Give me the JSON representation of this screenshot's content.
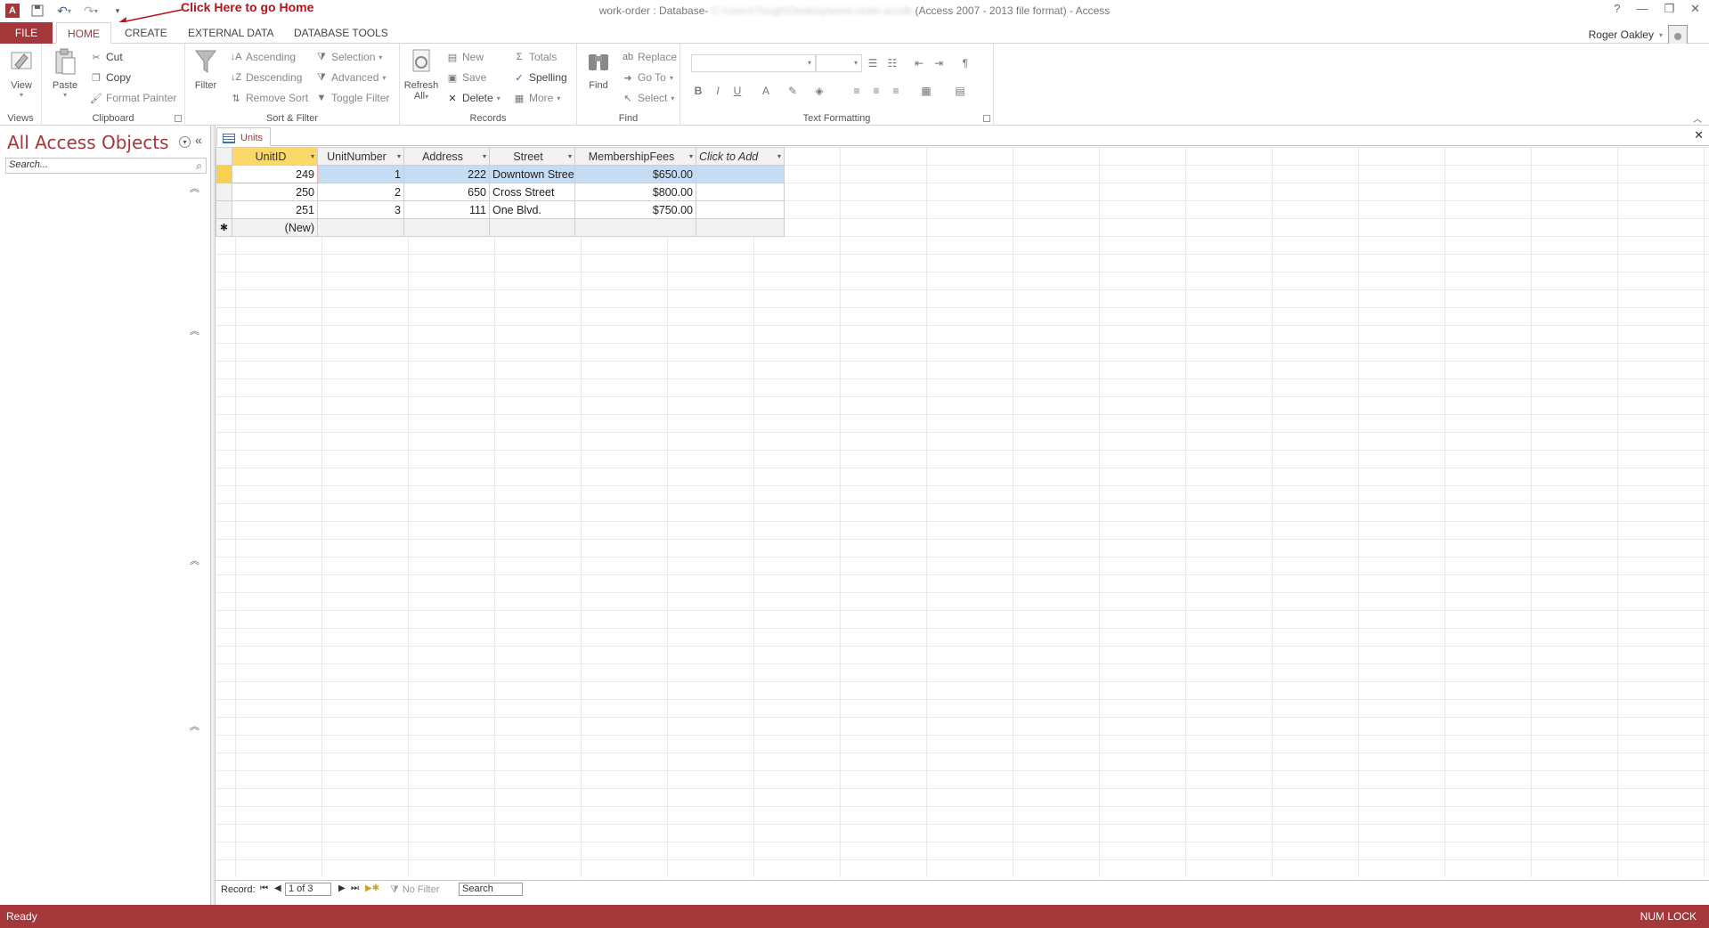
{
  "titlebar": {
    "title_prefix": "work-order : Database-",
    "title_blurred": "C:\\Users\\Tough\\Desktop\\work-order.accdb",
    "title_suffix": "(Access 2007 - 2013 file format) - Access",
    "annotation": "Click Here to go Home",
    "help": "?",
    "minimize": "—",
    "restore": "❐",
    "close": "✕"
  },
  "tabs": {
    "file": "FILE",
    "home": "HOME",
    "create": "CREATE",
    "external": "EXTERNAL DATA",
    "dbtools": "DATABASE TOOLS"
  },
  "user": {
    "name": "Roger Oakley"
  },
  "ribbon": {
    "views": {
      "label": "Views",
      "view": "View"
    },
    "clipboard": {
      "label": "Clipboard",
      "paste": "Paste",
      "cut": "Cut",
      "copy": "Copy",
      "format_painter": "Format Painter"
    },
    "sortfilter": {
      "label": "Sort & Filter",
      "filter": "Filter",
      "ascending": "Ascending",
      "descending": "Descending",
      "remove_sort": "Remove Sort",
      "selection": "Selection",
      "advanced": "Advanced",
      "toggle_filter": "Toggle Filter"
    },
    "records": {
      "label": "Records",
      "refresh": "Refresh",
      "refresh_all": "All",
      "new": "New",
      "save": "Save",
      "delete": "Delete",
      "totals": "Totals",
      "spelling": "Spelling",
      "more": "More"
    },
    "find": {
      "label": "Find",
      "find": "Find",
      "replace": "Replace",
      "goto": "Go To",
      "select": "Select"
    },
    "textformatting": {
      "label": "Text Formatting",
      "bold": "B",
      "italic": "I",
      "underline": "U",
      "fontcolor": "A"
    }
  },
  "navpane": {
    "title": "All Access Objects",
    "search_placeholder": "Search...",
    "collapse": "«"
  },
  "document": {
    "tab_label": "Units",
    "close": "✕"
  },
  "datasheet": {
    "columns": [
      "UnitID",
      "UnitNumber",
      "Address",
      "Street",
      "MembershipFees",
      "Click to Add"
    ],
    "rows": [
      [
        "249",
        "1",
        "222",
        "Downtown Street",
        "$650.00"
      ],
      [
        "250",
        "2",
        "650",
        "Cross Street",
        "$800.00"
      ],
      [
        "251",
        "3",
        "111",
        "One Blvd.",
        "$750.00"
      ]
    ],
    "new_row_label": "(New)",
    "new_row_marker": "✱"
  },
  "recordnav": {
    "label": "Record:",
    "position": "1 of 3",
    "no_filter": "No Filter",
    "search": "Search"
  },
  "status": {
    "left": "Ready",
    "right": "NUM LOCK"
  },
  "colors": {
    "accent": "#a4373a",
    "selected_row": "#c5dcf3",
    "current_record": "#f8d154"
  }
}
